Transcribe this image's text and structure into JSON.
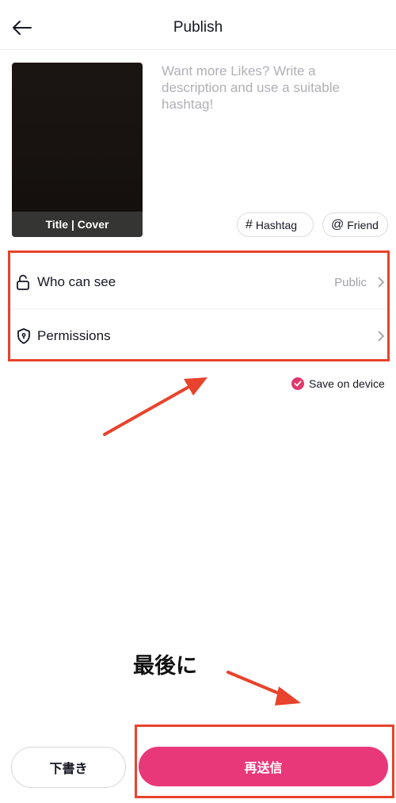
{
  "header": {
    "title": "Publish"
  },
  "cover": {
    "label": "Title | Cover"
  },
  "description": {
    "placeholder": "Want more Likes? Write a description and use a suitable hashtag!"
  },
  "chips": {
    "hashtag": "Hashtag",
    "friend": "Friend"
  },
  "settings": {
    "who_can_see": {
      "label": "Who can see",
      "value": "Public"
    },
    "permissions": {
      "label": "Permissions"
    }
  },
  "save_on_device": {
    "label": "Save on device",
    "checked": true
  },
  "annotation": {
    "note": "最後に"
  },
  "footer": {
    "draft_label": "下書き",
    "post_label": "再送信"
  },
  "colors": {
    "accent": "#e8387a",
    "annotation_red": "#e8432c",
    "check": "#e0386d"
  }
}
